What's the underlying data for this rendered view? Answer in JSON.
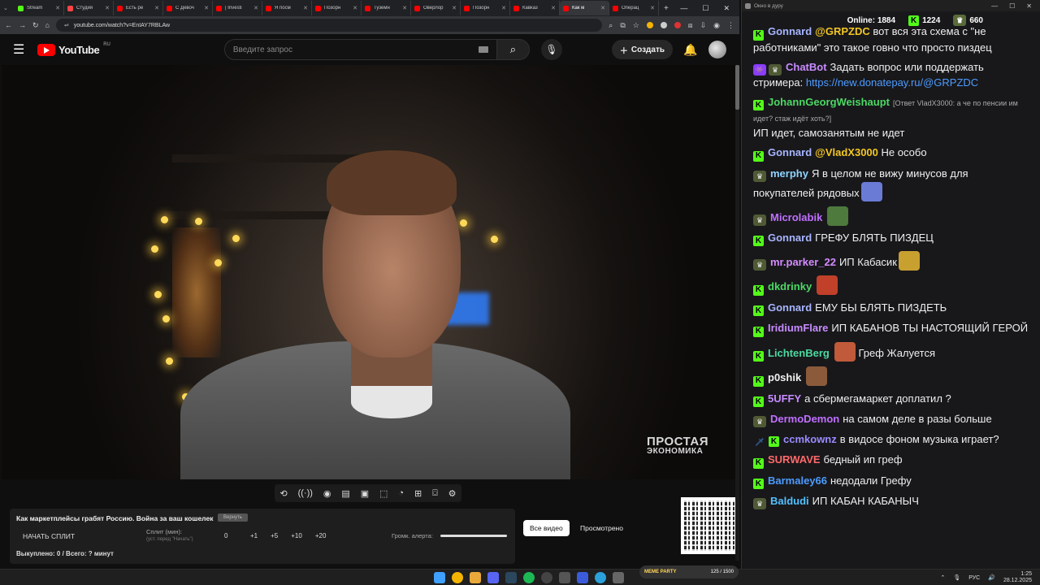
{
  "browser": {
    "tabs": [
      {
        "label": "Stream",
        "color": "#53fc18"
      },
      {
        "label": "Студия",
        "color": "#ff4444"
      },
      {
        "label": "Есть ре",
        "color": "#ff0000"
      },
      {
        "label": "С Девоч",
        "color": "#ff0000"
      },
      {
        "label": "| Investi",
        "color": "#ff0000"
      },
      {
        "label": "Я посм",
        "color": "#ff0000"
      },
      {
        "label": "Позорн",
        "color": "#ff0000"
      },
      {
        "label": "Туземн",
        "color": "#ff0000"
      },
      {
        "label": "Оверлор",
        "color": "#ff0000"
      },
      {
        "label": "Позорн",
        "color": "#ff0000"
      },
      {
        "label": "Кавказ",
        "color": "#ff0000"
      },
      {
        "label": "Как м",
        "color": "#ff0000",
        "active": true
      },
      {
        "label": "Операц",
        "color": "#ff0000"
      }
    ],
    "new_tab": "+",
    "url": "youtube.com/watch?v=EnIAY7RBLAw"
  },
  "youtube": {
    "logo_text": "YouTube",
    "region": "RU",
    "search_placeholder": "Введите запрос",
    "create_label": "Создать"
  },
  "video": {
    "watermark_line1": "ПРОСТАЯ",
    "watermark_line2": "ЭКОНОМИКА"
  },
  "panel": {
    "title": "Как маркетплейсы грабят Россию. Война за ваш кошелек",
    "restore_label": "Вернуть",
    "start_split": "НАЧАТЬ СПЛИТ",
    "split_label": "Сплит (мин):",
    "split_hint": "(уст. перед \"Начать\")",
    "split_value": "0",
    "increments": [
      "+1",
      "+5",
      "+10",
      "+20"
    ],
    "alert_volume_label": "Громк. алерта:",
    "bought": "Выкуплено: 0 / Всего: ? минут",
    "all_videos": "Все видео",
    "watched": "Просмотрено"
  },
  "chat": {
    "window_title": "Окно в дуру",
    "online_label": "Online:",
    "online_count": "1884",
    "kick_count": "1224",
    "crown_count": "660",
    "messages": [
      {
        "user": "Gonnard",
        "color": "#a7b5ff",
        "badges": [
          "kick"
        ],
        "mention": "@GRPZDC",
        "text": "вот вся эта схема с \"не работниками\" это такое говно что просто пиздец"
      },
      {
        "user": "ChatBot",
        "color": "#c88cff",
        "badges": [
          "bot",
          "crown"
        ],
        "text": "Задать вопрос или поддержать стримера:",
        "link": "https://new.donatepay.ru/@GRPZDC"
      },
      {
        "user": "JohannGeorgWeishaupt",
        "color": "#4cd964",
        "badges": [
          "kick"
        ],
        "reply": "[Ответ VladX3000: а че по пенсии им идет? стаж идёт хоть?]",
        "text": "ИП идет, самозанятым не идет"
      },
      {
        "user": "Gonnard",
        "color": "#a7b5ff",
        "badges": [
          "kick"
        ],
        "mention": "@VladX3000",
        "text": "Не особо"
      },
      {
        "user": "merphy",
        "color": "#8fd3ff",
        "badges": [
          "crown"
        ],
        "text": "Я в целом не вижу минусов для покупателей  рядовых",
        "emote": "#6a7bd6"
      },
      {
        "user": "Microlabik",
        "color": "#c070ff",
        "badges": [
          "crown"
        ],
        "text": "",
        "emote": "#4e7a3e"
      },
      {
        "user": "Gonnard",
        "color": "#a7b5ff",
        "badges": [
          "kick"
        ],
        "text": "ГРЕФУ БЛЯТЬ ПИЗДЕЦ"
      },
      {
        "user": "mr.parker_22",
        "color": "#d48cff",
        "badges": [
          "crown"
        ],
        "text": "ИП Кабасик",
        "emote": "#c8a030"
      },
      {
        "user": "dkdrinky",
        "color": "#4cd964",
        "badges": [
          "kick"
        ],
        "text": "",
        "emote": "#c0402a"
      },
      {
        "user": "Gonnard",
        "color": "#a7b5ff",
        "badges": [
          "kick"
        ],
        "text": "ЕМУ БЫ БЛЯТЬ ПИЗДЕТЬ"
      },
      {
        "user": "IridiumFlare",
        "color": "#c88cff",
        "badges": [
          "kick"
        ],
        "text": "ИП КАБАНОВ ТЫ НАСТОЯЩИЙ ГЕРОЙ"
      },
      {
        "user": "LichtenBerg",
        "color": "#4cd9a0",
        "badges": [
          "kick"
        ],
        "text": "Греф Жалуется",
        "emote_before": "#c05a3a"
      },
      {
        "user": "p0shik",
        "color": "#f0f0f0",
        "badges": [
          "kick"
        ],
        "text": "",
        "emote": "#8a5a3a"
      },
      {
        "user": "5UFFY",
        "color": "#c88cff",
        "badges": [
          "kick"
        ],
        "text": "а сбермегамаркет доплатил ?"
      },
      {
        "user": "DermoDemon",
        "color": "#c070ff",
        "badges": [
          "crown"
        ],
        "text": "на самом деле в разы больше"
      },
      {
        "user": "ccmkownz",
        "color": "#9a8cff",
        "badges": [
          "sword",
          "kick"
        ],
        "text": "в видосе фоном музыка играет?"
      },
      {
        "user": "SURWAVE",
        "color": "#ff6a6a",
        "badges": [
          "kick"
        ],
        "text": "бедный ип греф"
      },
      {
        "user": "Barmaley66",
        "color": "#4d9cff",
        "badges": [
          "kick"
        ],
        "text": "недодали Грефу"
      },
      {
        "user": "Baldudi",
        "color": "#53c0ff",
        "badges": [
          "crown"
        ],
        "text": "ИП КАБАН КАБАНЫЧ"
      }
    ]
  },
  "taskbar": {
    "meme_label": "MEME PARTY",
    "meme_count": "125 / 1500",
    "lang": "РУС",
    "time": "1:25",
    "date": "28.12.2025"
  }
}
